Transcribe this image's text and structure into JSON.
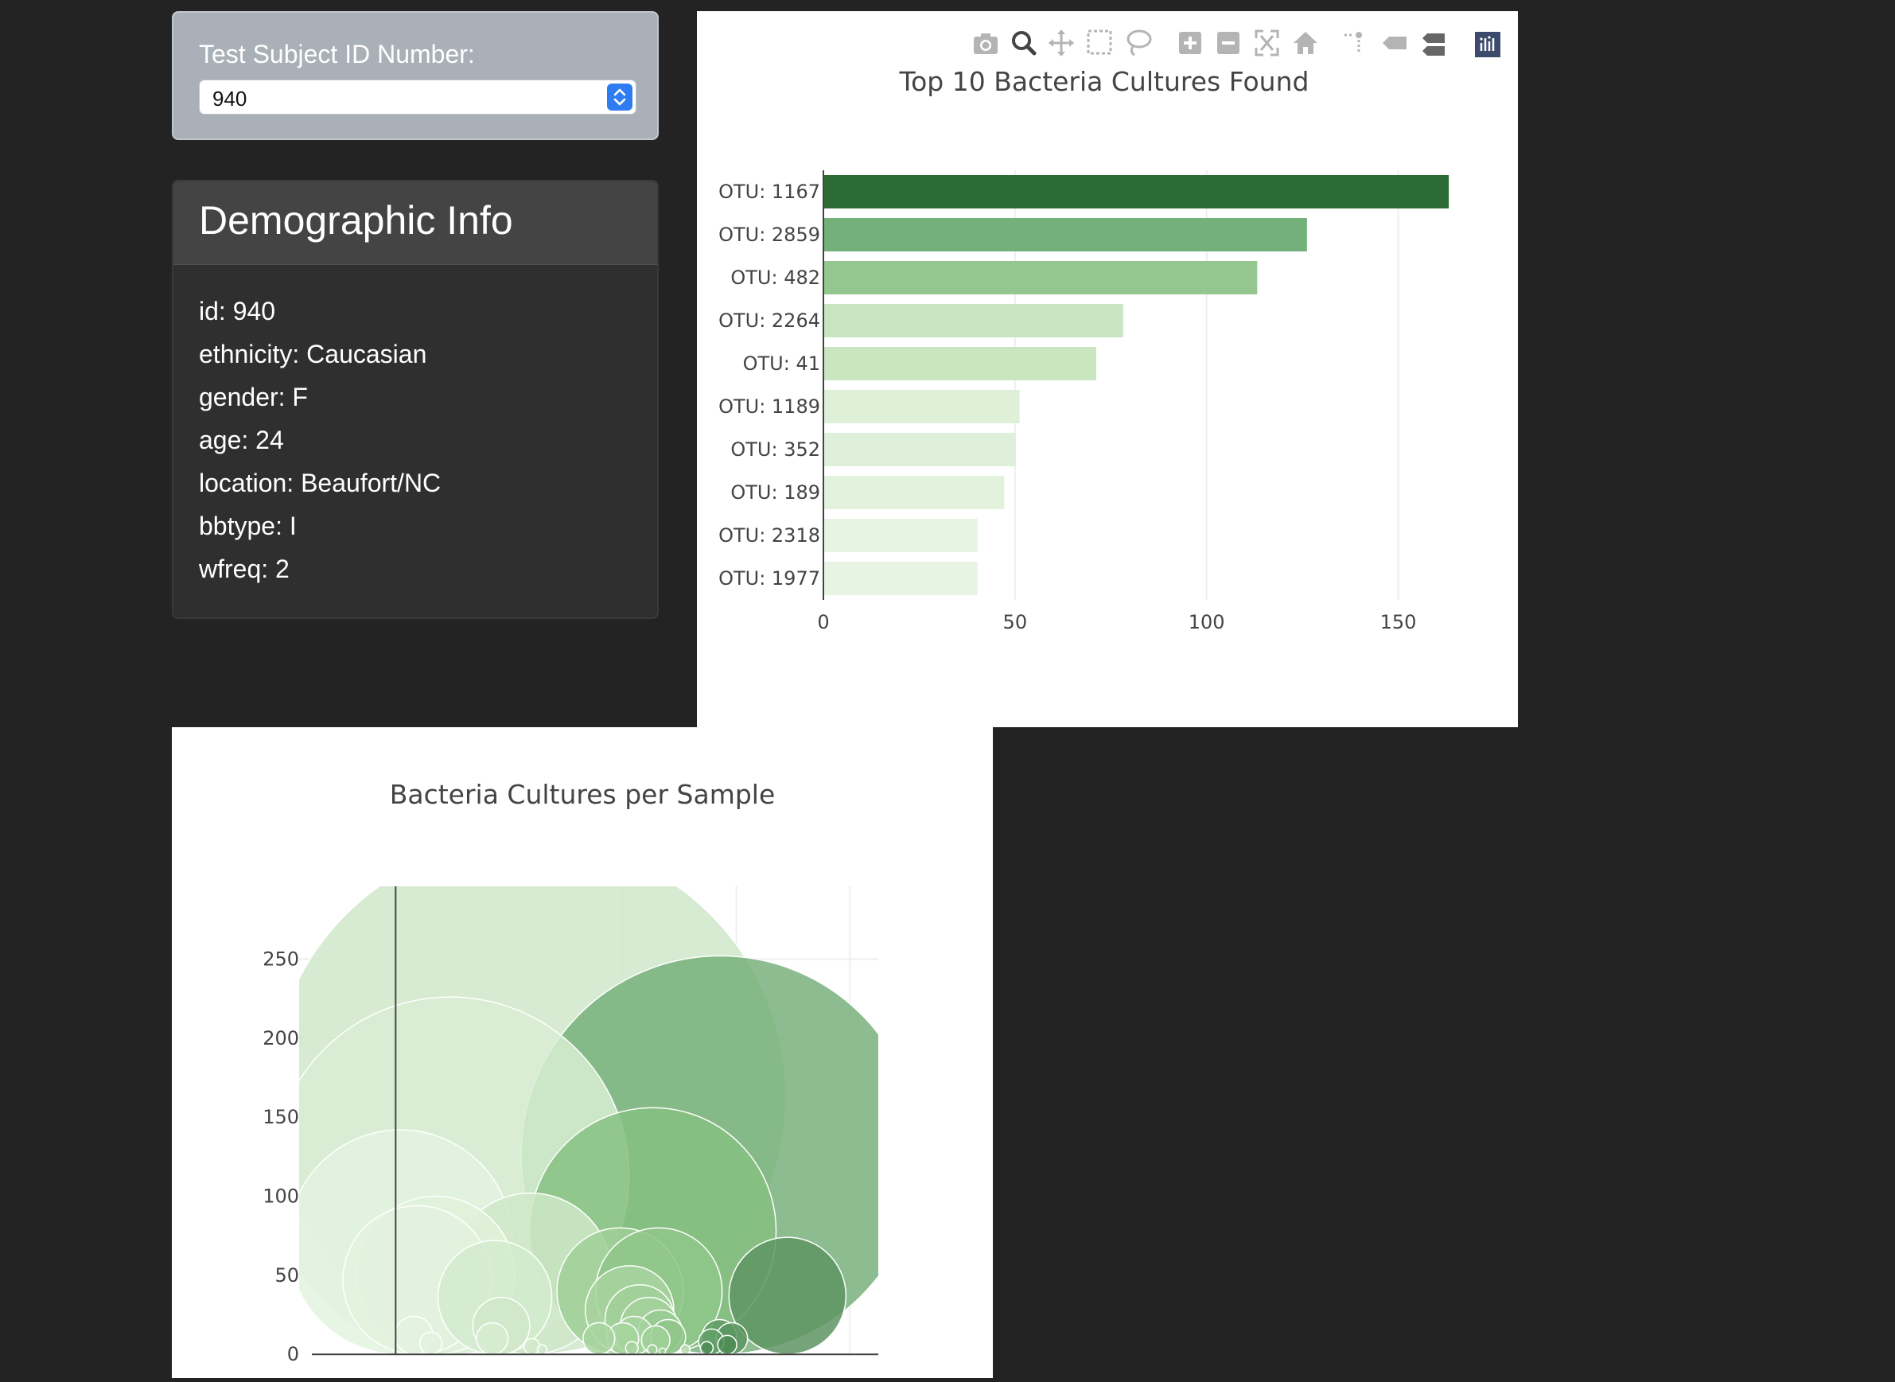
{
  "selector": {
    "label": "Test Subject ID Number:",
    "value": "940"
  },
  "demographics": {
    "title": "Demographic Info",
    "items": [
      "id: 940",
      "ethnicity: Caucasian",
      "gender: F",
      "age: 24",
      "location: Beaufort/NC",
      "bbtype: I",
      "wfreq: 2"
    ]
  },
  "modebar": {
    "icons": [
      "camera-icon",
      "zoom-icon",
      "pan-icon",
      "box-select-icon",
      "lasso-select-icon",
      "zoom-in-icon",
      "zoom-out-icon",
      "autoscale-icon",
      "reset-axes-icon",
      "spike-lines-icon",
      "hover-closest-icon",
      "hover-compare-icon",
      "plotly-logo-icon"
    ]
  },
  "chart_data": [
    {
      "type": "bar",
      "orientation": "horizontal",
      "title": "Top 10 Bacteria Cultures Found",
      "categories": [
        "OTU: 1167",
        "OTU: 2859",
        "OTU: 482",
        "OTU: 2264",
        "OTU: 41",
        "OTU: 1189",
        "OTU: 352",
        "OTU: 189",
        "OTU: 2318",
        "OTU: 1977"
      ],
      "values": [
        163,
        126,
        113,
        78,
        71,
        51,
        50,
        47,
        40,
        40
      ],
      "xlim": [
        0,
        180
      ],
      "xticks": [
        0,
        50,
        100,
        150
      ],
      "colors": [
        "#2d6b34",
        "#74b17a",
        "#93c78f",
        "#c6e5c0",
        "#c9e6c1",
        "#def0d8",
        "#dff0da",
        "#e2f2dd",
        "#e7f4e3",
        "#e7f4e3"
      ],
      "grid": true
    },
    {
      "type": "scatter",
      "subtype": "bubble",
      "title": "Bacteria Cultures per Sample",
      "xlim": [
        -850,
        4250
      ],
      "ylim": [
        -15,
        296
      ],
      "xticks": [
        0,
        1000,
        2000,
        3000,
        4000
      ],
      "yticks": [
        0,
        50,
        100,
        150,
        200,
        250
      ],
      "grid": true,
      "points": [
        {
          "x": 1167,
          "y": 163,
          "r": 163,
          "color": "#cfe8c9"
        },
        {
          "x": 482,
          "y": 113,
          "r": 113,
          "color": "#d8edd3"
        },
        {
          "x": 41,
          "y": 71,
          "r": 71,
          "color": "#e3f3df"
        },
        {
          "x": 352,
          "y": 50,
          "r": 50,
          "color": "#e0f1da"
        },
        {
          "x": 189,
          "y": 47,
          "r": 47,
          "color": "#e3f2de"
        },
        {
          "x": 1189,
          "y": 51,
          "r": 51,
          "color": "#cfe8c8"
        },
        {
          "x": 874,
          "y": 36,
          "r": 36,
          "color": "#d4ebce"
        },
        {
          "x": 930,
          "y": 18,
          "r": 18,
          "color": "#d0e9c9"
        },
        {
          "x": 2859,
          "y": 126,
          "r": 126,
          "color": "#78b07b"
        },
        {
          "x": 2264,
          "y": 78,
          "r": 78,
          "color": "#86c081"
        },
        {
          "x": 1977,
          "y": 40,
          "r": 40,
          "color": "#9fcf97"
        },
        {
          "x": 2318,
          "y": 40,
          "r": 40,
          "color": "#8fc689"
        },
        {
          "x": 2060,
          "y": 28,
          "r": 28,
          "color": "#a8d49f"
        },
        {
          "x": 2150,
          "y": 22,
          "r": 22,
          "color": "#a0d098"
        },
        {
          "x": 2230,
          "y": 18,
          "r": 18,
          "color": "#a4d19b"
        },
        {
          "x": 2330,
          "y": 14,
          "r": 14,
          "color": "#98cb90"
        },
        {
          "x": 2100,
          "y": 12,
          "r": 12,
          "color": "#a6d39d"
        },
        {
          "x": 2400,
          "y": 11,
          "r": 11,
          "color": "#8fc589"
        },
        {
          "x": 2000,
          "y": 10,
          "r": 10,
          "color": "#a6d39e"
        },
        {
          "x": 2290,
          "y": 9,
          "r": 9,
          "color": "#a0d098"
        },
        {
          "x": 1790,
          "y": 10,
          "r": 10,
          "color": "#a8d4a0"
        },
        {
          "x": 3450,
          "y": 37,
          "r": 37,
          "color": "#5e9463"
        },
        {
          "x": 2850,
          "y": 11,
          "r": 11,
          "color": "#5f9a62"
        },
        {
          "x": 2960,
          "y": 10,
          "r": 10,
          "color": "#5a9560"
        },
        {
          "x": 2780,
          "y": 8,
          "r": 8,
          "color": "#62a068"
        },
        {
          "x": 2920,
          "y": 6,
          "r": 6,
          "color": "#4f8c56"
        },
        {
          "x": 2740,
          "y": 4,
          "r": 4,
          "color": "#4f8c56"
        },
        {
          "x": 160,
          "y": 12,
          "r": 12,
          "color": "#e4f3e0"
        },
        {
          "x": 310,
          "y": 7,
          "r": 7,
          "color": "#e2f2de"
        },
        {
          "x": 850,
          "y": 10,
          "r": 10,
          "color": "#d6ecd0"
        },
        {
          "x": 1200,
          "y": 5,
          "r": 5,
          "color": "#d2eacb"
        },
        {
          "x": 1290,
          "y": 3,
          "r": 3,
          "color": "#d2eacb"
        },
        {
          "x": 2550,
          "y": 3,
          "r": 3,
          "color": "#b9dcb2"
        },
        {
          "x": 2080,
          "y": 4,
          "r": 4,
          "color": "#a8d49f"
        },
        {
          "x": 2260,
          "y": 3,
          "r": 3,
          "color": "#a0d098"
        },
        {
          "x": 2350,
          "y": 2,
          "r": 2,
          "color": "#98cb90"
        }
      ]
    }
  ]
}
